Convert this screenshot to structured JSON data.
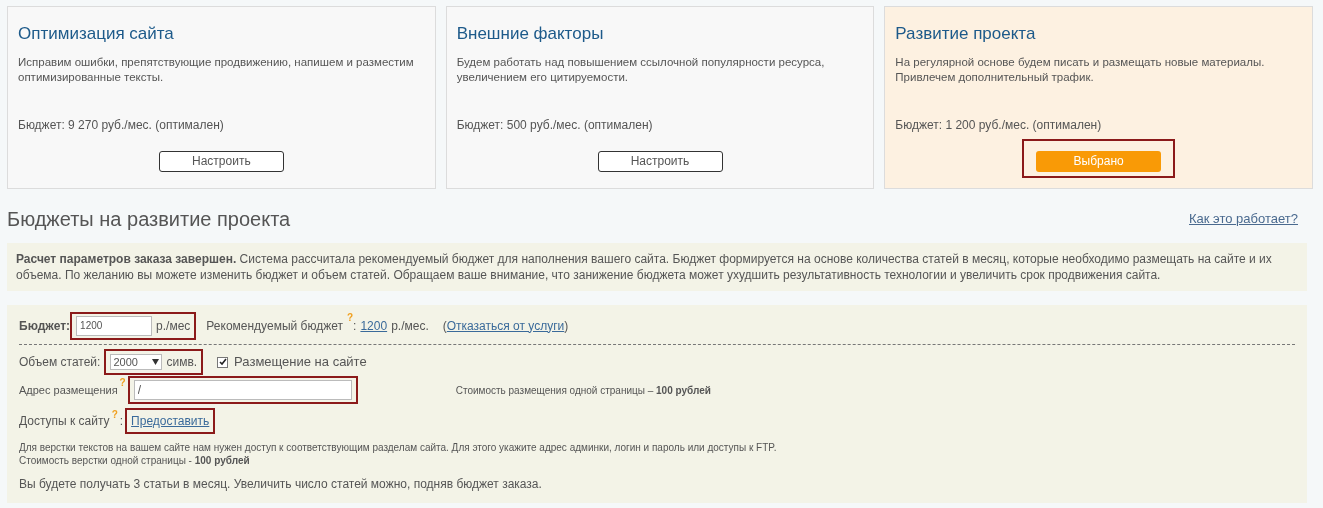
{
  "plans": [
    {
      "title": "Оптимизация сайта",
      "description": "Исправим ошибки, препятствующие продвижению, напишем и разместим оптимизированные тексты.",
      "budget": "Бюджет: 9 270 руб./мес. (оптимален)",
      "button": "Настроить",
      "selected": false,
      "highlighted": false
    },
    {
      "title": "Внешние факторы",
      "description": "Будем работать над повышением ссылочной популярности ресурса, увеличением его цитируемости.",
      "budget": "Бюджет: 500 руб./мес. (оптимален)",
      "button": "Настроить",
      "selected": false,
      "highlighted": false
    },
    {
      "title": "Развитие проекта",
      "description": "На регулярной основе будем писать и размещать новые материалы. Привлечем дополнительный трафик.",
      "budget": "Бюджет: 1 200 руб./мес. (оптимален)",
      "button": "Выбрано",
      "selected": true,
      "highlighted": true
    }
  ],
  "heading": "Бюджеты на развитие проекта",
  "help_link": "Как это работает?",
  "notice": "**Расчет параметров заказа завершен.** Система рассчитала рекомендуемый бюджет для наполнения вашего сайта. Бюджет формируется на основе количества статей в месяц, которые необходимо размещать на сайте и их объема. По желанию вы можете изменить бюджет и объем статей. Обращаем ваше внимание, что занижение бюджета может ухудшить результативность технологии и увеличить срок продвижения сайта.",
  "budget_row": {
    "label": "Бюджет:",
    "value": "1200",
    "unit": "р./мес",
    "highlighted": true,
    "recommended_label": "Рекомендуемый бюджет",
    "hint": "?",
    "colon": ":",
    "recommended_value": "1200",
    "recommended_unit": "р./мес.",
    "open_paren": "(",
    "decline_link": "Отказаться от услуги",
    "close_paren": ")"
  },
  "volume_row": {
    "label": "Объем статей:",
    "value": "2000",
    "unit": "симв.",
    "highlighted": true,
    "placement_label": "Размещение на сайте",
    "placement_checked": true
  },
  "address_row": {
    "label": "Адрес размещения",
    "hint": "?",
    "value": "/",
    "highlighted": true,
    "cost": "Стоимость размещения одной страницы – **100 рублей**"
  },
  "access_row": {
    "label": "Доступы к сайту",
    "hint": "?",
    "colon": ":",
    "link": "Предоставить",
    "highlighted": true
  },
  "access_note": "Для верстки текстов на вашем сайте нам нужен доступ к соответствующим разделам сайта. Для этого укажите адрес админки, логин и пароль или доступы к FTP.",
  "layout_cost": "Стоимость верстки одной страницы - **100 рублей**",
  "summary": "Вы будете получать 3 статьи в месяц. Увеличить число статей можно, подняв бюджет заказа."
}
